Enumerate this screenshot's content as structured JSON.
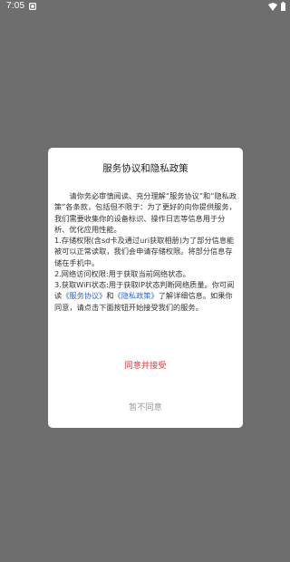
{
  "status_bar": {
    "time": "7:05",
    "notification_icon": "notification-square-icon",
    "wifi_icon": "wifi-icon",
    "battery_icon": "battery-icon"
  },
  "dialog": {
    "title": "服务协议和隐私政策",
    "body_part1": "请你务必审慎阅读、充分理解“服务协议”和“隐私政策”各条款，包括但不限于：为了更好的向你提供服务，我们需要收集你的设备标识、操作日志等信息用于分析、优化应用性能。",
    "body_item1": "1.存储权限(含sd卡及通过uri获取相册)为了部分信息能被可以正常读取，我们会申请存储权限。将部分信息存储在手机中。",
    "body_item2": "2.网络访问权限:用于获取当前网络状态。",
    "body_item3_prefix": "3.获取WiFi状态:用于获取IP状态判断网络质量。你可阅读",
    "link_service": "《服务协议》",
    "and_text": "和",
    "link_privacy": "《隐私政策》",
    "body_item3_suffix": "了解详细信息。如果你同意，请点击下面按钮开始接受我们的服务。",
    "agree_label": "同意并接受",
    "disagree_label": "暂不同意",
    "colors": {
      "agree": "#e03a3a",
      "disagree": "#9a9a9a",
      "link": "#2b6bd6",
      "overlay": "#6e6e6e"
    }
  }
}
